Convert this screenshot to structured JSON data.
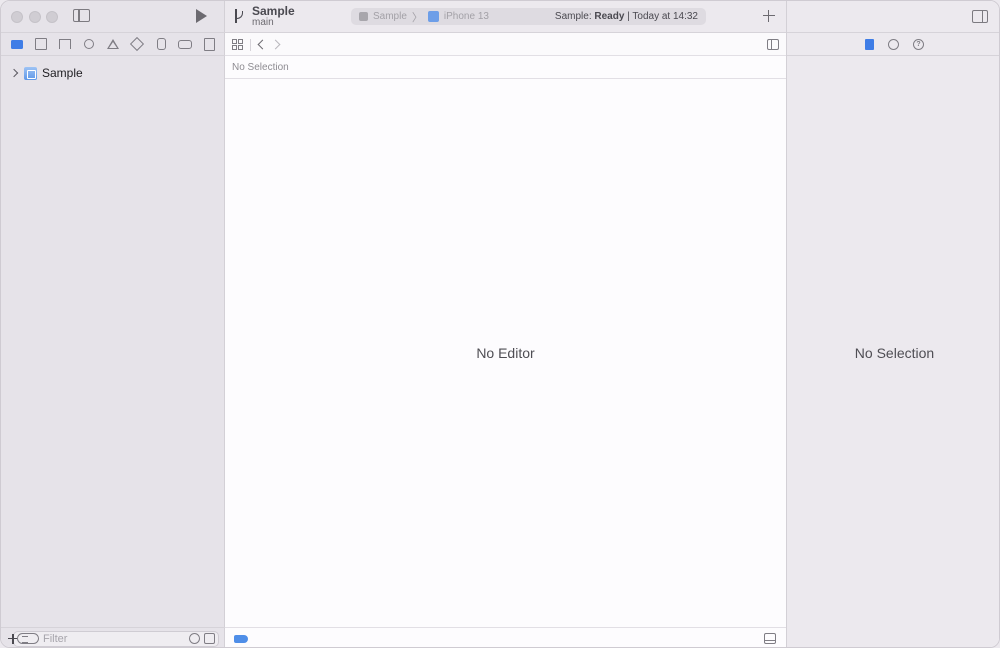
{
  "toolbar": {
    "project_name": "Sample",
    "branch": "main",
    "activity": {
      "scheme": "Sample",
      "separator": "〉",
      "device": "iPhone 13",
      "status_prefix": "Sample:",
      "status_state": "Ready",
      "status_suffix": "| Today at 14:32"
    }
  },
  "navigator": {
    "tree": [
      {
        "label": "Sample",
        "expanded": false
      }
    ],
    "filter_placeholder": "Filter"
  },
  "editor": {
    "path_text": "No Selection",
    "empty_message": "No Editor"
  },
  "inspector": {
    "empty_message": "No Selection",
    "help_glyph": "?"
  },
  "colors": {
    "accent": "#3f7de6",
    "breakpoint": "#4f8ee8"
  }
}
